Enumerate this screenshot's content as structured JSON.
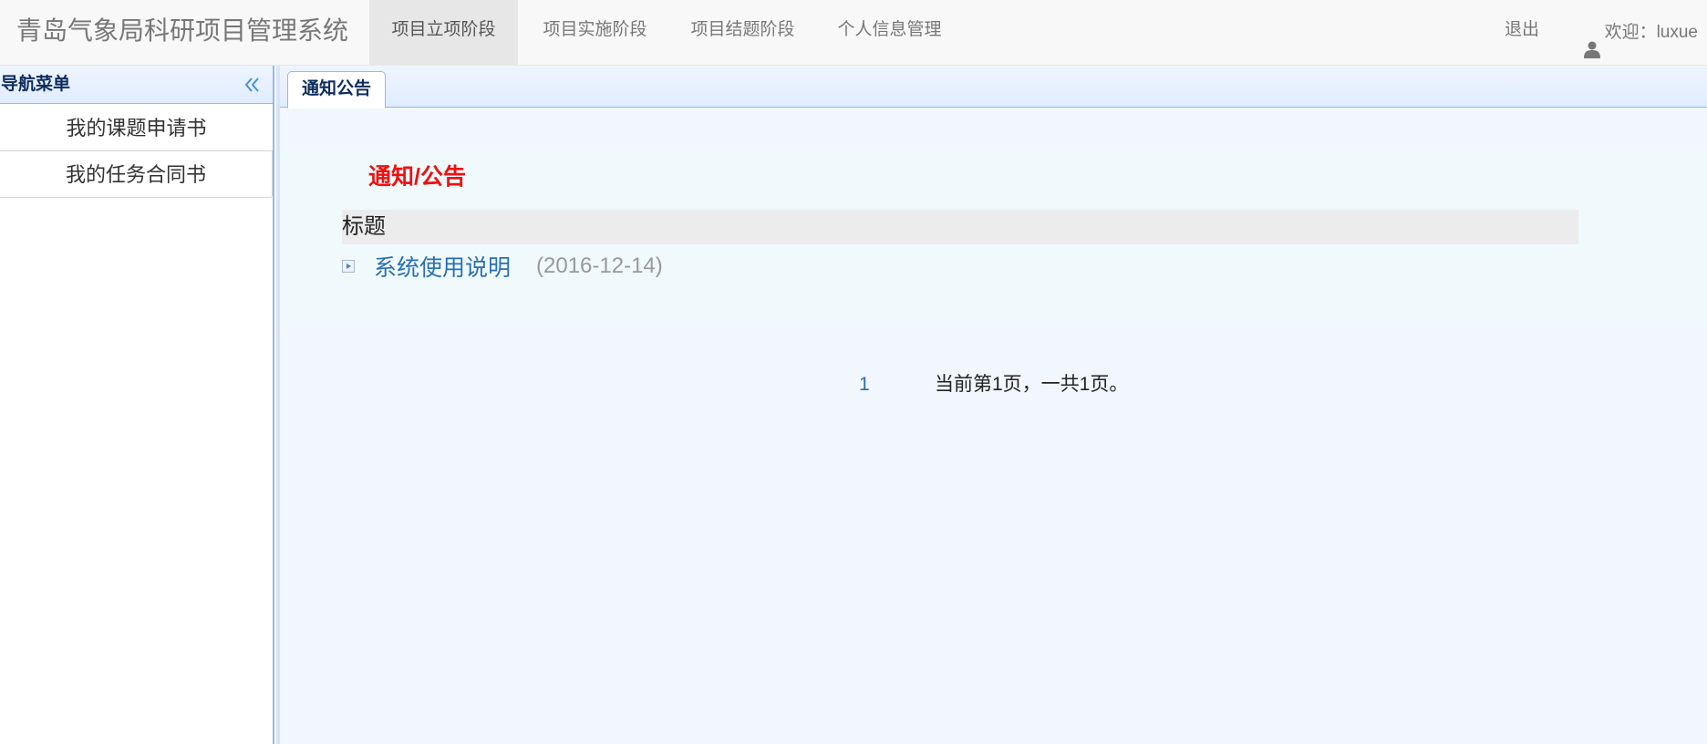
{
  "app": {
    "title": "青岛气象局科研项目管理系统"
  },
  "navbar": {
    "items": [
      {
        "label": "项目立项阶段",
        "active": true
      },
      {
        "label": "项目实施阶段",
        "active": false
      },
      {
        "label": "项目结题阶段",
        "active": false
      },
      {
        "label": "个人信息管理",
        "active": false
      }
    ],
    "logout_label": "退出",
    "welcome_text": "欢迎：luxue",
    "user_icon": "user-icon"
  },
  "sidebar": {
    "title": "导航菜单",
    "collapse_icon": "double-chevron-left-icon",
    "items": [
      {
        "label": "我的课题申请书"
      },
      {
        "label": "我的任务合同书"
      }
    ]
  },
  "tabs": [
    {
      "label": "通知公告",
      "active": true
    }
  ],
  "notice": {
    "heading": "通知/公告",
    "column_header": "标题",
    "items": [
      {
        "title": "系统使用说明",
        "date": "(2016-12-14)",
        "icon": "arrow-bullet-icon"
      }
    ]
  },
  "pager": {
    "page_link": "1",
    "status": "当前第1页，一共1页。"
  },
  "colors": {
    "accent_blue": "#95b8e7",
    "link_blue": "#2a6fb3",
    "notice_red": "#ee1111",
    "navbar_bg": "#f8f8f8"
  }
}
